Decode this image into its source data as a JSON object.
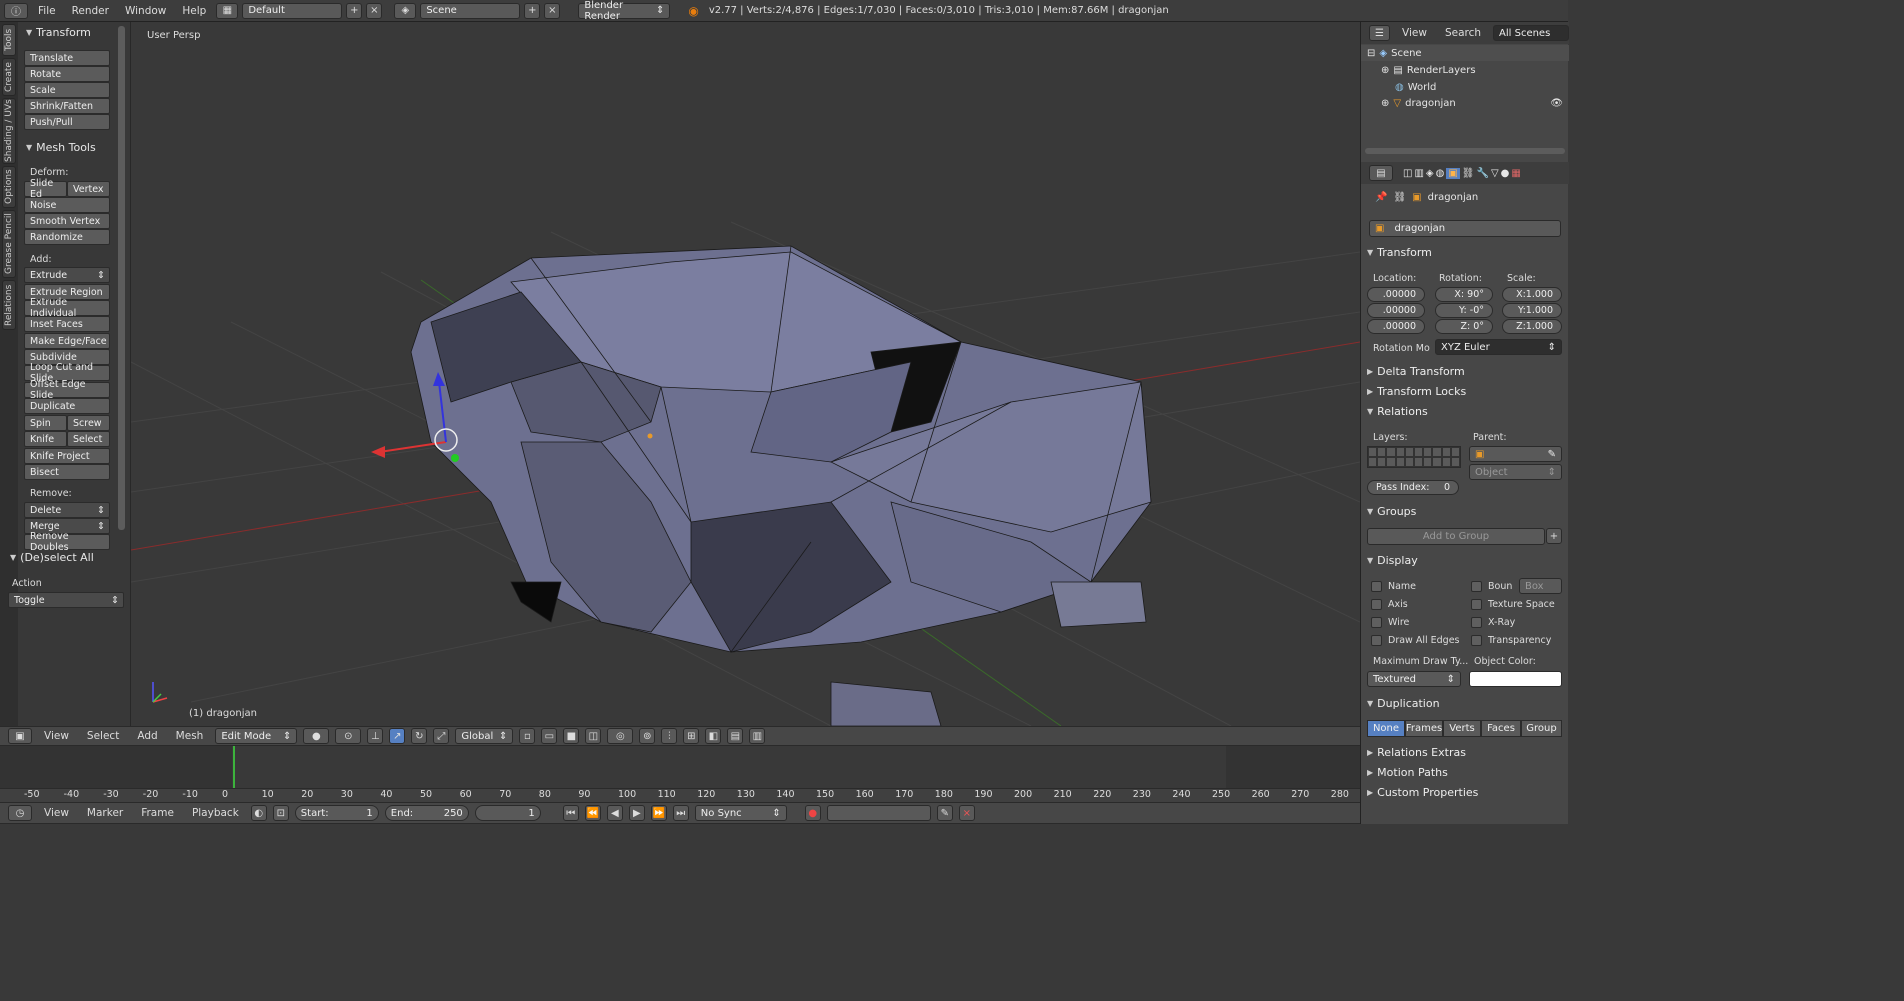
{
  "topbar": {
    "menus": [
      "File",
      "Render",
      "Window",
      "Help"
    ],
    "screen_layout": "Default",
    "scene": "Scene",
    "engine": "Blender Render",
    "stats": "v2.77 | Verts:2/4,876 | Edges:1/7,030 | Faces:0/3,010 | Tris:3,010 | Mem:87.66M | dragonjan"
  },
  "tool_tabs": [
    "Tools",
    "Create",
    "Shading / UVs",
    "Options",
    "Grease Pencil",
    "Relations"
  ],
  "tools": {
    "transform_header": "Transform",
    "transform_buttons": [
      "Translate",
      "Rotate",
      "Scale",
      "Shrink/Fatten",
      "Push/Pull"
    ],
    "mesh_tools_header": "Mesh Tools",
    "deform_label": "Deform:",
    "slide_edge": "Slide Ed",
    "vertex": "Vertex",
    "noise": "Noise",
    "smooth_vertex": "Smooth Vertex",
    "randomize": "Randomize",
    "add_label": "Add:",
    "extrude": "Extrude",
    "add_buttons": [
      "Extrude Region",
      "Extrude Individual",
      "Inset Faces",
      "Make Edge/Face",
      "Subdivide",
      "Loop Cut and Slide",
      "Offset Edge Slide",
      "Duplicate"
    ],
    "spin": "Spin",
    "screw": "Screw",
    "knife": "Knife",
    "select": "Select",
    "knife_project": "Knife Project",
    "bisect": "Bisect",
    "remove_label": "Remove:",
    "delete": "Delete",
    "merge": "Merge",
    "remove_doubles": "Remove Doubles",
    "deselect_header": "(De)select All",
    "action_label": "Action",
    "action_value": "Toggle"
  },
  "viewport": {
    "view_label": "User Persp",
    "object_label": "(1) dragonjan",
    "colors": {
      "bg": "#393939",
      "mesh": "#6b6e8c",
      "grid": "#4a4a4a"
    }
  },
  "view3d_header": {
    "menus": [
      "View",
      "Select",
      "Add",
      "Mesh"
    ],
    "mode": "Edit Mode",
    "orientation": "Global"
  },
  "timeline": {
    "ticks": [
      "-50",
      "-40",
      "-30",
      "-20",
      "-10",
      "0",
      "10",
      "20",
      "30",
      "40",
      "50",
      "60",
      "70",
      "80",
      "90",
      "100",
      "110",
      "120",
      "130",
      "140",
      "150",
      "160",
      "170",
      "180",
      "190",
      "200",
      "210",
      "220",
      "230",
      "240",
      "250",
      "260",
      "270",
      "280"
    ],
    "current_frame": 1,
    "menus": [
      "View",
      "Marker",
      "Frame",
      "Playback"
    ],
    "start_label": "Start:",
    "start": "1",
    "end_label": "End:",
    "end": "250",
    "frame": "1",
    "sync": "No Sync"
  },
  "outliner": {
    "menus": [
      "View",
      "Search"
    ],
    "filter": "All Scenes",
    "items": [
      "Scene",
      "RenderLayers",
      "World",
      "dragonjan"
    ]
  },
  "properties": {
    "breadcrumb": "dragonjan",
    "object_name": "dragonjan",
    "transform_header": "Transform",
    "location_label": "Location:",
    "rotation_label": "Rotation:",
    "scale_label": "Scale:",
    "location": [
      ".00000",
      ".00000",
      ".00000"
    ],
    "rotation": [
      "X:   90°",
      "Y:   -0°",
      "Z:    0°"
    ],
    "scale": [
      "X:1.000",
      "Y:1.000",
      "Z:1.000"
    ],
    "rotation_mode_label": "Rotation Mo",
    "rotation_mode": "XYZ Euler",
    "delta_transform": "Delta Transform",
    "transform_locks": "Transform Locks",
    "relations": "Relations",
    "layers_label": "Layers:",
    "parent_label": "Parent:",
    "parent_type": "Object",
    "pass_index_label": "Pass Index:",
    "pass_index": "0",
    "groups": "Groups",
    "add_to_group": "Add to Group",
    "display": "Display",
    "display_left": [
      "Name",
      "Axis",
      "Wire",
      "Draw All Edges"
    ],
    "bounds": "Boun",
    "bounds_type": "Box",
    "display_right": [
      "Texture Space",
      "X-Ray",
      "Transparency"
    ],
    "max_draw_label": "Maximum Draw Ty...",
    "object_color_label": "Object Color:",
    "max_draw": "Textured",
    "duplication": "Duplication",
    "dup_tabs": [
      "None",
      "Frames",
      "Verts",
      "Faces",
      "Group"
    ],
    "relations_extras": "Relations Extras",
    "motion_paths": "Motion Paths",
    "custom_properties": "Custom Properties",
    "accent": "#5680c2"
  }
}
